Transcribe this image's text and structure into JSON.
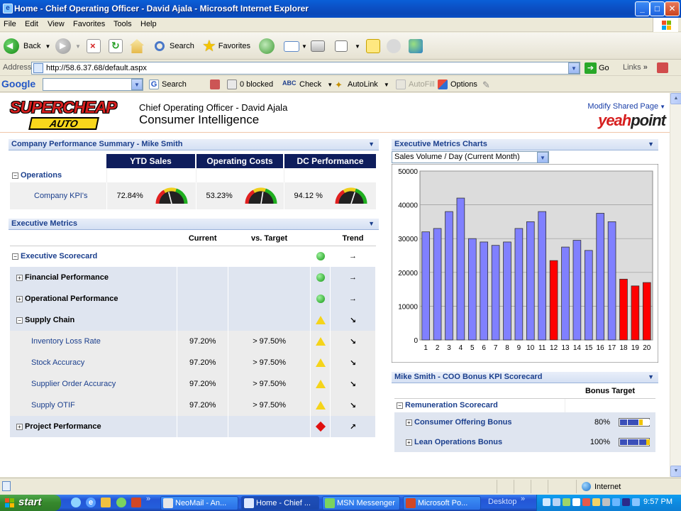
{
  "window": {
    "title": "Home - Chief Operating Officer - David Ajala - Microsoft Internet Explorer",
    "minimize": "_",
    "maximize": "□",
    "close": "✕"
  },
  "menu": [
    "File",
    "Edit",
    "View",
    "Favorites",
    "Tools",
    "Help"
  ],
  "toolbar": {
    "back": "Back",
    "search": "Search",
    "favorites": "Favorites"
  },
  "address": {
    "label": "Address",
    "url": "http://58.6.37.68/default.aspx",
    "go": "Go",
    "links": "Links",
    "links_chevron": "»"
  },
  "googlebar": {
    "logo": "Google",
    "search": "Search",
    "blocked": "0 blocked",
    "check": "Check",
    "autolink": "AutoLink",
    "autofill": "AutoFill",
    "options": "Options"
  },
  "header": {
    "subtitle": "Chief Operating Officer - David Ajala",
    "title": "Consumer Intelligence",
    "modify_link": "Modify Shared Page",
    "modify_chevron": "▼",
    "logo_top": "SUPERCHEAP",
    "logo_bottom": "AUTO",
    "brand_a": "yeah",
    "brand_b": "point"
  },
  "company_performance": {
    "title": "Company Performance Summary - Mike Smith",
    "columns": [
      "YTD Sales",
      "Operating Costs",
      "DC Performance"
    ],
    "group_label": "Operations",
    "row_label": "Company KPI's",
    "values": [
      {
        "text": "72.84%",
        "gauge_level": 0.42
      },
      {
        "text": "53.23%",
        "gauge_level": 0.55
      },
      {
        "text": "94.12 %",
        "gauge_level": 0.6
      }
    ]
  },
  "executive_metrics": {
    "title": "Executive Metrics",
    "columns": {
      "current": "Current",
      "target": "vs. Target",
      "trend": "Trend"
    },
    "rows": [
      {
        "label": "Executive Scorecard",
        "pm": "−",
        "current": "",
        "target": "",
        "status": "green",
        "trend": "→"
      },
      {
        "label": "Financial Performance",
        "pm": "+",
        "current": "",
        "target": "",
        "status": "green",
        "trend": "→"
      },
      {
        "label": "Operational Performance",
        "pm": "+",
        "current": "",
        "target": "",
        "status": "green",
        "trend": "→"
      },
      {
        "label": "Supply Chain",
        "pm": "−",
        "current": "",
        "target": "",
        "status": "yellow",
        "trend": "↘"
      },
      {
        "label": "Inventory Loss Rate",
        "pm": "",
        "current": "97.20%",
        "target": "> 97.50%",
        "status": "yellow",
        "trend": "↘"
      },
      {
        "label": "Stock Accuracy",
        "pm": "",
        "current": "97.20%",
        "target": "> 97.50%",
        "status": "yellow",
        "trend": "↘"
      },
      {
        "label": "Supplier Order Accuracy",
        "pm": "",
        "current": "97.20%",
        "target": "> 97.50%",
        "status": "yellow",
        "trend": "↘"
      },
      {
        "label": "Supply OTIF",
        "pm": "",
        "current": "97.20%",
        "target": "> 97.50%",
        "status": "yellow",
        "trend": "↘"
      },
      {
        "label": "Project Performance",
        "pm": "+",
        "current": "",
        "target": "",
        "status": "red",
        "trend": "↗"
      }
    ]
  },
  "chart_panel": {
    "title": "Executive Metrics Charts",
    "selector": "Sales Volume / Day (Current Month)"
  },
  "chart_data": {
    "type": "bar",
    "categories": [
      "1",
      "2",
      "3",
      "4",
      "5",
      "6",
      "7",
      "8",
      "9",
      "10",
      "11",
      "12",
      "13",
      "14",
      "15",
      "16",
      "17",
      "18",
      "19",
      "20"
    ],
    "values": [
      32000,
      33000,
      38000,
      42000,
      30000,
      29000,
      28000,
      29000,
      33000,
      35000,
      38000,
      23500,
      27500,
      29500,
      26500,
      37500,
      35000,
      18000,
      16000,
      17000
    ],
    "highlight_categories": [
      "12",
      "18",
      "19",
      "20"
    ],
    "ylim": [
      0,
      50000
    ],
    "yticks": [
      0,
      10000,
      20000,
      30000,
      40000,
      50000
    ],
    "grid": true,
    "colors": {
      "normal": "#8080ff",
      "highlight": "#ff0000",
      "plot_bg": "#dcdcdc"
    }
  },
  "bonus": {
    "title": "Mike Smith - COO Bonus KPI Scorecard",
    "column": "Bonus Target",
    "group_label": "Remuneration Scorecard",
    "rows": [
      {
        "label": "Consumer Offering Bonus",
        "value": "80%",
        "level": 0.8
      },
      {
        "label": "Lean Operations Bonus",
        "value": "100%",
        "level": 1.0
      }
    ]
  },
  "status": {
    "zone": "Internet"
  },
  "taskbar": {
    "start": "start",
    "chevron": "»",
    "tasks": [
      "NeoMail - An...",
      "Home - Chief ...",
      "MSN Messenger",
      "Microsoft Po..."
    ],
    "desktop": "Desktop",
    "clock": "9:57 PM"
  }
}
